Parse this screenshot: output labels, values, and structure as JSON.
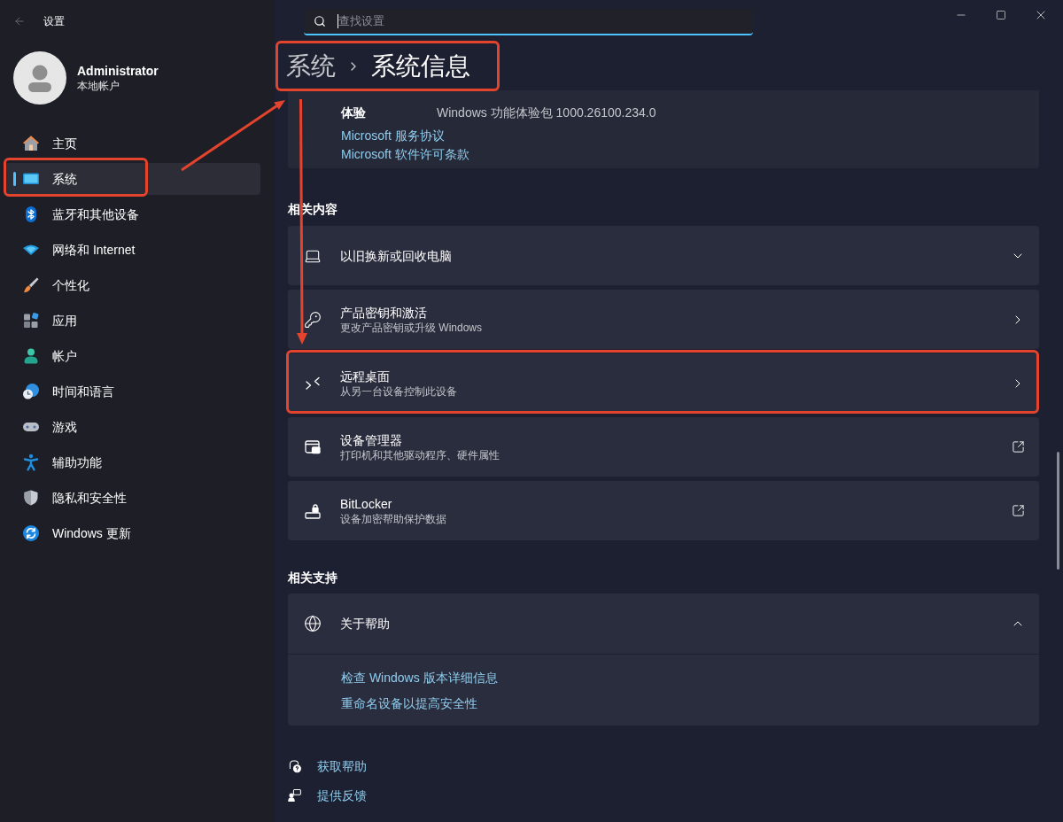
{
  "window": {
    "title": "设置"
  },
  "search": {
    "placeholder": "查找设置"
  },
  "profile": {
    "name": "Administrator",
    "account_type": "本地帐户"
  },
  "nav": [
    {
      "label": "主页",
      "selected": false
    },
    {
      "label": "系统",
      "selected": true
    },
    {
      "label": "蓝牙和其他设备",
      "selected": false
    },
    {
      "label": "网络和 Internet",
      "selected": false
    },
    {
      "label": "个性化",
      "selected": false
    },
    {
      "label": "应用",
      "selected": false
    },
    {
      "label": "帐户",
      "selected": false
    },
    {
      "label": "时间和语言",
      "selected": false
    },
    {
      "label": "游戏",
      "selected": false
    },
    {
      "label": "辅助功能",
      "selected": false
    },
    {
      "label": "隐私和安全性",
      "selected": false
    },
    {
      "label": "Windows 更新",
      "selected": false
    }
  ],
  "breadcrumb": {
    "parent": "系统",
    "current": "系统信息"
  },
  "info_card": {
    "rows": [
      {
        "label": "体验",
        "value": "Windows 功能体验包 1000.26100.234.0"
      }
    ],
    "links": [
      "Microsoft 服务协议",
      "Microsoft 软件许可条款"
    ]
  },
  "related_content": {
    "heading": "相关内容",
    "items": [
      {
        "title": "以旧换新或回收电脑",
        "kind": "expander",
        "expanded": false
      },
      {
        "title": "产品密钥和激活",
        "subtitle": "更改产品密钥或升级 Windows",
        "kind": "link"
      },
      {
        "title": "远程桌面",
        "subtitle": "从另一台设备控制此设备",
        "kind": "link"
      },
      {
        "title": "设备管理器",
        "subtitle": "打印机和其他驱动程序、硬件属性",
        "kind": "external"
      },
      {
        "title": "BitLocker",
        "subtitle": "设备加密帮助保护数据",
        "kind": "external"
      }
    ]
  },
  "related_support": {
    "heading": "相关支持",
    "items": [
      {
        "title": "关于帮助",
        "kind": "expander",
        "expanded": true,
        "links": [
          "检查 Windows 版本详细信息",
          "重命名设备以提高安全性"
        ]
      }
    ]
  },
  "footer_links": [
    "获取帮助",
    "提供反馈"
  ]
}
